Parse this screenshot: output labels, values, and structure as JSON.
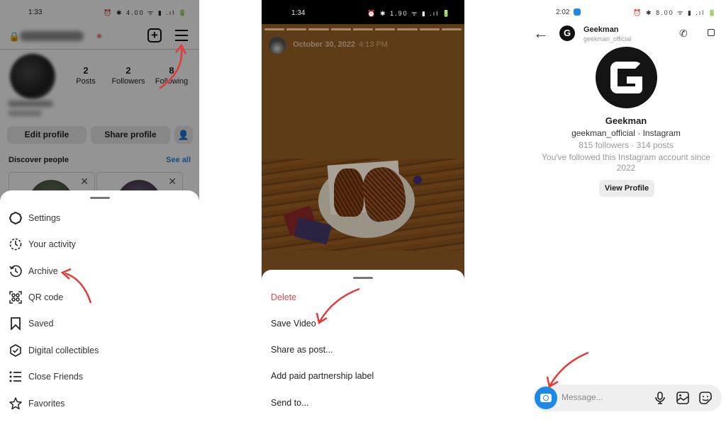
{
  "left_panel": {
    "status_bar": {
      "time": "1:33",
      "icons": "⏰ ✱ 4.00 ᯤ ▮ .ıl 🔋"
    },
    "stats": [
      {
        "value": "2",
        "label": "Posts"
      },
      {
        "value": "2",
        "label": "Followers"
      },
      {
        "value": "8",
        "label": "Following"
      }
    ],
    "buttons": {
      "edit_profile": "Edit profile",
      "share_profile": "Share profile"
    },
    "discover": {
      "title": "Discover people",
      "see_all": "See all"
    },
    "menu_items": [
      {
        "icon": "settings-icon",
        "label": "Settings"
      },
      {
        "icon": "activity-icon",
        "label": "Your activity"
      },
      {
        "icon": "archive-icon",
        "label": "Archive"
      },
      {
        "icon": "qr-code-icon",
        "label": "QR code"
      },
      {
        "icon": "bookmark-icon",
        "label": "Saved"
      },
      {
        "icon": "collectibles-icon",
        "label": "Digital collectibles"
      },
      {
        "icon": "close-friends-icon",
        "label": "Close Friends"
      },
      {
        "icon": "star-icon",
        "label": "Favorites"
      }
    ]
  },
  "middle_panel": {
    "status_bar": {
      "time": "1:34",
      "icons": "⏰ ✱ 1.90 ᯤ ▮ .ıl 🔋"
    },
    "story": {
      "date": "October 30, 2022",
      "time": "4:13 PM",
      "segments": 9
    },
    "options": [
      {
        "label": "Delete",
        "style": "danger"
      },
      {
        "label": "Save Video",
        "style": "normal"
      },
      {
        "label": "Share as post...",
        "style": "normal"
      },
      {
        "label": "Add paid partnership label",
        "style": "normal"
      },
      {
        "label": "Send to...",
        "style": "normal"
      }
    ]
  },
  "right_panel": {
    "status_bar": {
      "time": "2:02",
      "icons": "⏰ ✱ 8.00 ᯤ ▮ .ıl 🔋"
    },
    "header": {
      "name": "Geekman",
      "handle": "geekman_official"
    },
    "profile": {
      "avatar_letter": "G",
      "name": "Geekman",
      "handle_line": "geekman_official · Instagram",
      "stats_line": "815 followers · 314 posts",
      "since_line": "You've followed this Instagram account since 2022",
      "view_profile": "View Profile"
    },
    "composer": {
      "placeholder": "Message..."
    }
  },
  "colors": {
    "accent_blue": "#1e88e5",
    "danger_red": "#e0454f",
    "annotation_red": "#e53935",
    "story_brown": "#5e3c18"
  }
}
